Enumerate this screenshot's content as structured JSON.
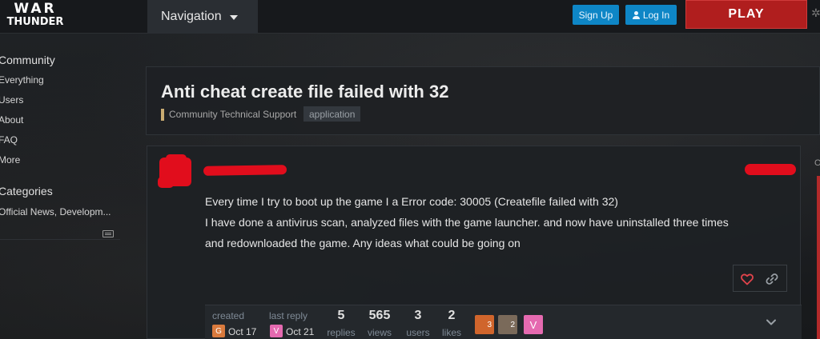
{
  "header": {
    "logo_line1": "WAR",
    "logo_line2": "THUNDER",
    "navigation_label": "Navigation",
    "signup_label": "Sign Up",
    "login_label": "Log In",
    "play_label": "PLAY"
  },
  "sidebar": {
    "community_heading": "Community",
    "community_items": [
      "Everything",
      "Users",
      "About",
      "FAQ",
      "More"
    ],
    "categories_heading": "Categories",
    "category_items": [
      "Official News, Developm..."
    ]
  },
  "topic": {
    "title": "Anti cheat create file failed with 32",
    "category": "Community Technical Support",
    "category_color": "#c9ac72",
    "tag": "application"
  },
  "post": {
    "body_line1": "Every time I try to boot up the game I a Error code: 30005 (Createfile failed with 32)",
    "body_line2": "I have done a antivirus scan, analyzed files with the game launcher. and now have uninstalled three times",
    "body_line3": "and redownloaded the game. Any ideas what could be going on",
    "redaction_color": "#e10d1c"
  },
  "topic_map": {
    "created_label": "created",
    "created_avatar": "G",
    "created_avatar_color": "#d97a3d",
    "created_date": "Oct 17",
    "last_reply_label": "last reply",
    "last_reply_avatar": "V",
    "last_reply_avatar_color": "#e56ab0",
    "last_reply_date": "Oct 21",
    "stats": [
      {
        "value": "5",
        "label": "replies"
      },
      {
        "value": "565",
        "label": "views"
      },
      {
        "value": "3",
        "label": "users"
      },
      {
        "value": "2",
        "label": "likes"
      }
    ],
    "participants": [
      {
        "letter": "3",
        "color": "#d0652c"
      },
      {
        "letter": "2",
        "color": "#7a6a5a"
      },
      {
        "letter": "V",
        "color": "#e56ab0"
      }
    ]
  },
  "right_stub_text": "O"
}
